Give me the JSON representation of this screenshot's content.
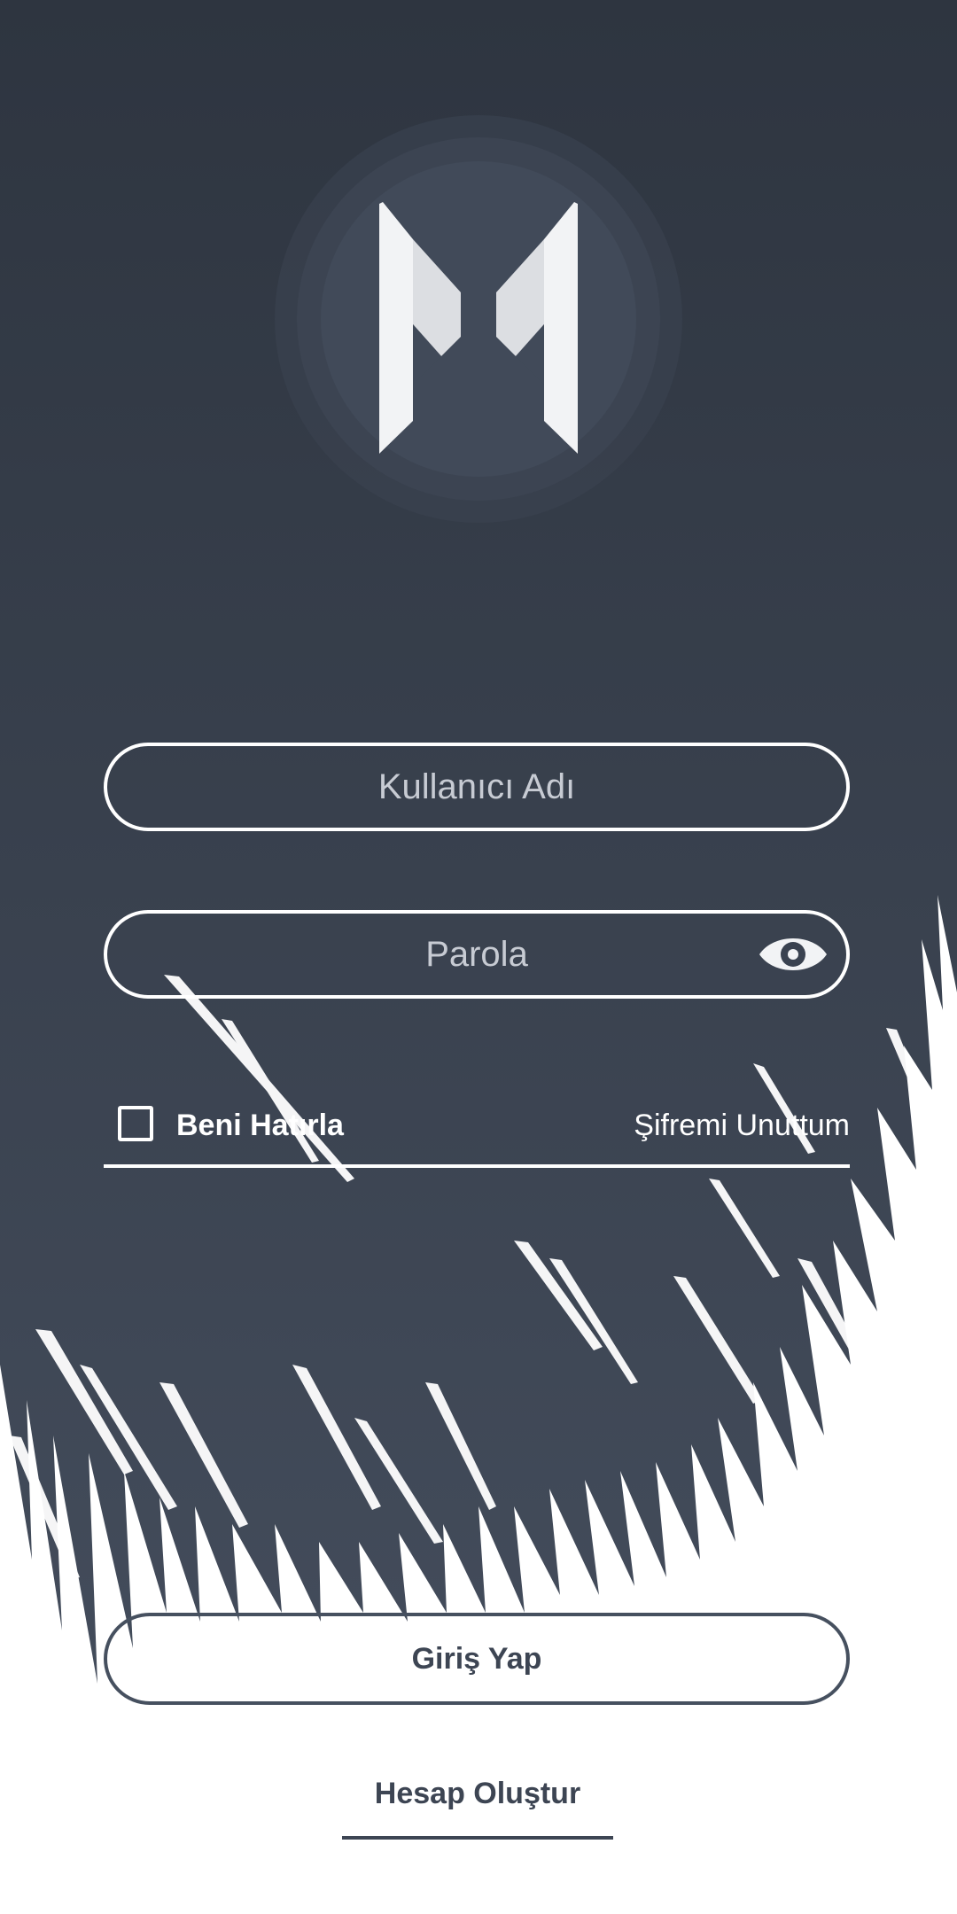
{
  "logo": {
    "icon": "m-logo-icon"
  },
  "form": {
    "username_placeholder": "Kullanıcı Adı",
    "username_value": "",
    "password_placeholder": "Parola",
    "password_value": "",
    "password_toggle_icon": "eye-icon",
    "remember_me_label": "Beni Hatırla",
    "remember_me_checked": false,
    "forgot_password_label": "Şifremi Unuttum"
  },
  "actions": {
    "login_label": "Giriş Yap",
    "signup_label": "Hesap Oluştur"
  },
  "colors": {
    "dark_bg_top": "#2e3540",
    "dark_bg_bottom": "#424b59",
    "accent_white": "#ffffff",
    "button_text": "#3d4553"
  }
}
